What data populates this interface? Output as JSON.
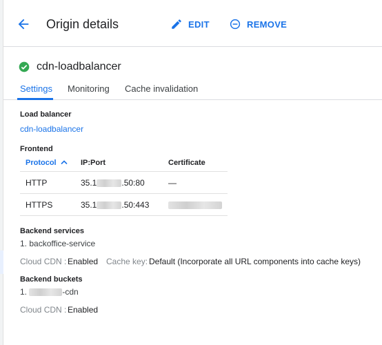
{
  "header": {
    "title": "Origin details",
    "edit_label": "EDIT",
    "remove_label": "REMOVE"
  },
  "origin": {
    "name": "cdn-loadbalancer",
    "status": "healthy"
  },
  "tabs": [
    {
      "label": "Settings",
      "active": true
    },
    {
      "label": "Monitoring",
      "active": false
    },
    {
      "label": "Cache invalidation",
      "active": false
    }
  ],
  "load_balancer": {
    "label": "Load balancer",
    "value": "cdn-loadbalancer"
  },
  "frontend": {
    "label": "Frontend",
    "columns": [
      "Protocol",
      "IP:Port",
      "Certificate"
    ],
    "sort_indicator": "^",
    "rows": [
      {
        "protocol": "HTTP",
        "ip_prefix": "35.1",
        "ip_suffix": ".50:80",
        "certificate": "—"
      },
      {
        "protocol": "HTTPS",
        "ip_prefix": "35.1",
        "ip_suffix": ".50:443",
        "certificate": ""
      }
    ]
  },
  "backend_services": {
    "label": "Backend services",
    "item": "1. backoffice-service",
    "cdn_label": "Cloud CDN :",
    "cdn_value": "Enabled",
    "cache_key_label": "Cache key:",
    "cache_key_value": "Default (Incorporate all URL components into cache keys)"
  },
  "backend_buckets": {
    "label": "Backend buckets",
    "item_prefix": "1.",
    "item_suffix": "-cdn",
    "cdn_label": "Cloud CDN :",
    "cdn_value": "Enabled"
  },
  "colors": {
    "accent": "#1a73e8",
    "success": "#34a853"
  }
}
